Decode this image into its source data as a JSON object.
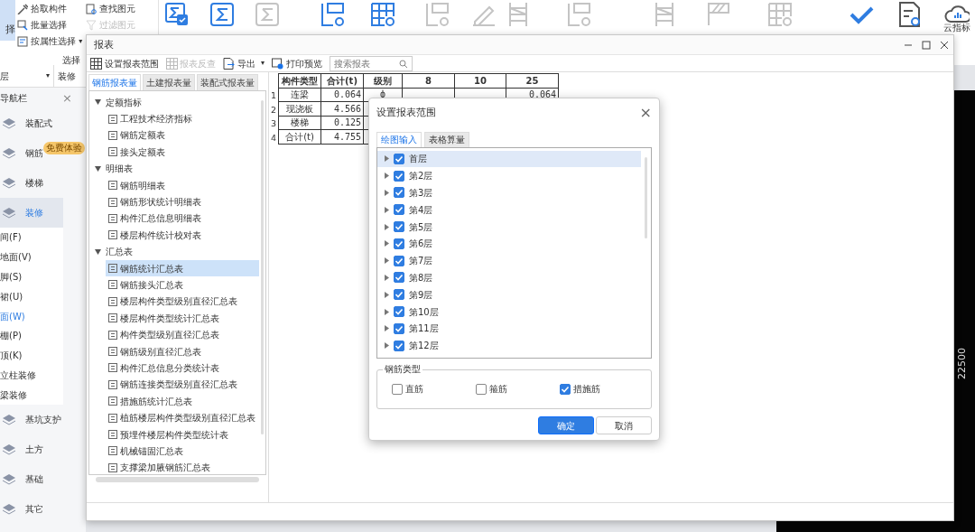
{
  "ribbon": {
    "select_label": "择",
    "tools": [
      {
        "label": "拾取构件",
        "disabled": false
      },
      {
        "label": "批量选择",
        "disabled": false
      },
      {
        "label": "按属性选择",
        "disabled": false,
        "caret": "▾"
      }
    ],
    "tools2": [
      {
        "label": "查找图元",
        "disabled": false
      },
      {
        "label": "过滤图元",
        "disabled": true
      }
    ],
    "group_label": "选择",
    "big_buttons": [
      {
        "kind": "sigma-check",
        "disabled": false
      },
      {
        "kind": "sigma",
        "disabled": false
      },
      {
        "kind": "sigma",
        "disabled": true
      },
      {
        "kind": "grid-search",
        "disabled": false
      },
      {
        "kind": "table-search",
        "disabled": false
      },
      {
        "kind": "grid-search",
        "disabled": true
      },
      {
        "kind": "pen",
        "disabled": true
      },
      {
        "kind": "rack",
        "disabled": true
      },
      {
        "kind": "grid-search",
        "disabled": true
      },
      {
        "kind": "rack",
        "disabled": true
      },
      {
        "kind": "hatch",
        "disabled": true
      },
      {
        "kind": "table-search",
        "disabled": true
      },
      {
        "kind": "check",
        "disabled": false
      },
      {
        "kind": "doc-search",
        "disabled": false
      },
      {
        "kind": "cloud",
        "disabled": false,
        "label": "云指标"
      }
    ]
  },
  "nav": {
    "floor": "层",
    "floor_caret": "▾",
    "discipline": "装修",
    "title": "导航栏",
    "close": "×",
    "categories": [
      {
        "label": "装配式",
        "selected": false
      },
      {
        "label": "钢筋",
        "selected": false,
        "badge": "免费体验"
      },
      {
        "label": "楼梯",
        "selected": false
      },
      {
        "label": "装修",
        "selected": true,
        "children": [
          {
            "label": "间(F)",
            "selected": false
          },
          {
            "label": "地面(V)",
            "selected": false
          },
          {
            "label": "脚(S)",
            "selected": false
          },
          {
            "label": "裙(U)",
            "selected": false
          },
          {
            "label": "面(W)",
            "selected": true
          },
          {
            "label": "棚(P)",
            "selected": false
          },
          {
            "label": "顶(K)",
            "selected": false
          },
          {
            "label": "立柱装修",
            "selected": false
          },
          {
            "label": "梁装修",
            "selected": false
          }
        ]
      },
      {
        "label": "基坑支护",
        "selected": false
      },
      {
        "label": "土方",
        "selected": false
      },
      {
        "label": "基础",
        "selected": false
      },
      {
        "label": "其它",
        "selected": false
      }
    ]
  },
  "report": {
    "title": "报表",
    "toolbar": [
      {
        "label": "设置报表范围",
        "disabled": false
      },
      {
        "label": "报表反查",
        "disabled": true
      },
      {
        "label": "导出",
        "disabled": false,
        "caret": "▾"
      },
      {
        "label": "打印预览",
        "disabled": false
      }
    ],
    "search": {
      "placeholder": "搜索报表"
    },
    "tabs": [
      {
        "label": "钢筋报表量",
        "selected": true
      },
      {
        "label": "土建报表量",
        "selected": false
      },
      {
        "label": "装配式报表量",
        "selected": false
      }
    ],
    "tree": [
      {
        "label": "定额指标",
        "expanded": true,
        "children": [
          {
            "label": "工程技术经济指标",
            "selected": false
          },
          {
            "label": "钢筋定额表",
            "selected": false
          },
          {
            "label": "接头定额表",
            "selected": false
          }
        ]
      },
      {
        "label": "明细表",
        "expanded": true,
        "children": [
          {
            "label": "钢筋明细表",
            "selected": false
          },
          {
            "label": "钢筋形状统计明细表",
            "selected": false
          },
          {
            "label": "构件汇总信息明细表",
            "selected": false
          },
          {
            "label": "楼层构件统计校对表",
            "selected": false
          }
        ]
      },
      {
        "label": "汇总表",
        "expanded": true,
        "children": [
          {
            "label": "钢筋统计汇总表",
            "selected": true
          },
          {
            "label": "钢筋接头汇总表",
            "selected": false
          },
          {
            "label": "楼层构件类型级别直径汇总表",
            "selected": false
          },
          {
            "label": "楼层构件类型统计汇总表",
            "selected": false
          },
          {
            "label": "构件类型级别直径汇总表",
            "selected": false
          },
          {
            "label": "钢筋级别直径汇总表",
            "selected": false
          },
          {
            "label": "构件汇总信息分类统计表",
            "selected": false
          },
          {
            "label": "钢筋连接类型级别直径汇总表",
            "selected": false
          },
          {
            "label": "措施筋统计汇总表",
            "selected": false
          },
          {
            "label": "植筋楼层构件类型级别直径汇总表",
            "selected": false
          },
          {
            "label": "预埋件楼层构件类型统计表",
            "selected": false
          },
          {
            "label": "机械锚固汇总表",
            "selected": false
          },
          {
            "label": "支撑梁加腋钢筋汇总表",
            "selected": false
          }
        ]
      }
    ],
    "table": {
      "columns": [
        "构件类型",
        "合计(t)",
        "级别",
        "8",
        "10",
        "25"
      ],
      "rows": [
        {
          "index": "1",
          "cells": [
            "连梁",
            "0.064",
            "ф",
            "",
            "",
            "0.064"
          ]
        },
        {
          "index": "2",
          "cells": [
            "现浇板",
            "4.566"
          ]
        },
        {
          "index": "3",
          "cells": [
            "楼梯",
            "0.125"
          ]
        },
        {
          "index": "4",
          "cells": [
            "合计(t)",
            "4.755"
          ]
        }
      ]
    }
  },
  "dialog": {
    "title": "设置报表范围",
    "close": "×",
    "tabs": [
      {
        "label": "绘图输入",
        "selected": true
      },
      {
        "label": "表格算量",
        "selected": false
      }
    ],
    "floors": [
      {
        "label": "首层",
        "checked": true,
        "selected": true
      },
      {
        "label": "第2层",
        "checked": true,
        "selected": false
      },
      {
        "label": "第3层",
        "checked": true,
        "selected": false
      },
      {
        "label": "第4层",
        "checked": true,
        "selected": false
      },
      {
        "label": "第5层",
        "checked": true,
        "selected": false
      },
      {
        "label": "第6层",
        "checked": true,
        "selected": false
      },
      {
        "label": "第7层",
        "checked": true,
        "selected": false
      },
      {
        "label": "第8层",
        "checked": true,
        "selected": false
      },
      {
        "label": "第9层",
        "checked": true,
        "selected": false
      },
      {
        "label": "第10层",
        "checked": true,
        "selected": false
      },
      {
        "label": "第11层",
        "checked": true,
        "selected": false
      },
      {
        "label": "第12层",
        "checked": true,
        "selected": false
      }
    ],
    "group": "钢筋类型",
    "options": [
      {
        "label": "直筋",
        "checked": false
      },
      {
        "label": "箍筋",
        "checked": false
      },
      {
        "label": "措施筋",
        "checked": true
      }
    ],
    "buttons": [
      {
        "label": "确定",
        "kind": "primary"
      },
      {
        "label": "取消",
        "kind": "secondary"
      }
    ]
  },
  "canvas": {
    "dimension": "22500"
  }
}
